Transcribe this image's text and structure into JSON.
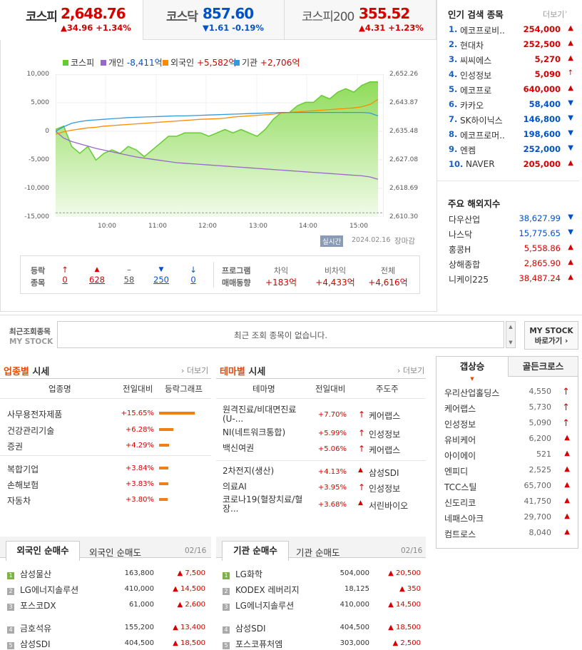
{
  "tabs": [
    {
      "name": "코스피",
      "value": "2,648.76",
      "change": "▲34.96 +1.34%",
      "dir": "up"
    },
    {
      "name": "코스닥",
      "value": "857.60",
      "change": "▼1.61 -0.19%",
      "dir": "dn"
    },
    {
      "name": "코스피200",
      "value": "355.52",
      "change": "▲4.31 +1.23%",
      "dir": "up"
    }
  ],
  "legend": [
    {
      "name": "코스피",
      "value": "",
      "color": "#66cc33"
    },
    {
      "name": "개인",
      "value": "-8,411억",
      "color": "#9966cc",
      "dir": "dn"
    },
    {
      "name": "외국인",
      "value": "+5,582억",
      "color": "#ff8a00",
      "dir": "up"
    },
    {
      "name": "기관",
      "value": "+2,706억",
      "color": "#3399dd",
      "dir": "up"
    }
  ],
  "chart_data": {
    "type": "line",
    "title": "",
    "x": [
      "09:00",
      "10:00",
      "11:00",
      "12:00",
      "13:00",
      "14:00",
      "15:00",
      "15:30"
    ],
    "x_ticks": [
      "10:00",
      "11:00",
      "12:00",
      "13:00",
      "14:00",
      "15:00"
    ],
    "ylim_left": [
      -15000,
      10000
    ],
    "y_ticks_left": [
      "10,000",
      "5,000",
      "0",
      "-5,000",
      "-10,000",
      "-15,000"
    ],
    "ylim_right": [
      2610.3,
      2652.26
    ],
    "y_ticks_right": [
      "2,652.26",
      "2,643.87",
      "2,635.48",
      "2,627.08",
      "2,618.69",
      "2,610.30"
    ],
    "series": [
      {
        "name": "코스피",
        "axis": "right",
        "type": "area",
        "color": "#66cc33",
        "values": [
          2636,
          2637,
          2631,
          2629,
          2631,
          2627,
          2629,
          2630,
          2629,
          2631,
          2630,
          2628,
          2630,
          2632,
          2634,
          2634,
          2635,
          2635,
          2635,
          2634,
          2635,
          2636,
          2635,
          2636,
          2635,
          2634,
          2636,
          2639,
          2641,
          2641,
          2643,
          2644,
          2644,
          2646,
          2645,
          2647,
          2648,
          2647,
          2649,
          2650,
          2650
        ]
      },
      {
        "name": "개인",
        "axis": "left",
        "values": [
          0,
          -1200,
          -1800,
          -2200,
          -2600,
          -3000,
          -3300,
          -3600,
          -3900,
          -4200,
          -4500,
          -4700,
          -4900,
          -5100,
          -5300,
          -5500,
          -5600,
          -5700,
          -5800,
          -5900,
          -6000,
          -6100,
          -6200,
          -6300,
          -6400,
          -6500,
          -6600,
          -6700,
          -6800,
          -6900,
          -7000,
          -7100,
          -7200,
          -7300,
          -7400,
          -7500,
          -7600,
          -7700,
          -7800,
          -8000,
          -8411
        ]
      },
      {
        "name": "외국인",
        "axis": "left",
        "values": [
          -500,
          -100,
          200,
          400,
          600,
          700,
          900,
          1000,
          1100,
          1200,
          1300,
          1400,
          1500,
          1600,
          1700,
          1800,
          1900,
          2000,
          2100,
          2150,
          2200,
          2300,
          2500,
          2600,
          2700,
          2800,
          2900,
          3000,
          3200,
          3300,
          3400,
          3500,
          3600,
          3700,
          3800,
          3900,
          4000,
          4100,
          4300,
          4700,
          5582
        ]
      },
      {
        "name": "기관",
        "axis": "left",
        "values": [
          0,
          800,
          1400,
          1700,
          1900,
          2000,
          2100,
          2200,
          2300,
          2400,
          2450,
          2500,
          2550,
          2600,
          2650,
          2700,
          2700,
          2750,
          2800,
          2850,
          2900,
          2950,
          3000,
          3050,
          3100,
          3150,
          3200,
          3250,
          3300,
          3300,
          3300,
          3300,
          3300,
          3300,
          3300,
          3300,
          3300,
          3300,
          3300,
          3200,
          2706
        ]
      }
    ]
  },
  "chart_footer": {
    "badge": "실시간",
    "date": "2024.02.16",
    "status": "장마감"
  },
  "stats": {
    "head1": "등락",
    "head2": "종목",
    "items": [
      {
        "sym": "↑",
        "val": "0",
        "dir": "up"
      },
      {
        "sym": "▲",
        "val": "628",
        "dir": "up"
      },
      {
        "sym": "–",
        "val": "58",
        "dir": "eq"
      },
      {
        "sym": "▼",
        "val": "250",
        "dir": "dn"
      },
      {
        "sym": "↓",
        "val": "0",
        "dir": "dn"
      }
    ],
    "prog1": "프로그램",
    "prog2": "매매동향",
    "prog": [
      {
        "label": "차익",
        "val": "+183억"
      },
      {
        "label": "비차익",
        "val": "+4,433억"
      },
      {
        "label": "전체",
        "val": "+4,616억"
      }
    ]
  },
  "popular": {
    "title": "인기 검색 종목",
    "more": "더보기",
    "items": [
      {
        "rank": "1.",
        "name": "에코프로비..",
        "value": "254,000",
        "arrow": "▲",
        "dir": "up"
      },
      {
        "rank": "2.",
        "name": "현대차",
        "value": "252,500",
        "arrow": "▲",
        "dir": "up"
      },
      {
        "rank": "3.",
        "name": "씨씨에스",
        "value": "5,270",
        "arrow": "▲",
        "dir": "up"
      },
      {
        "rank": "4.",
        "name": "인성정보",
        "value": "5,090",
        "arrow": "↑",
        "dir": "up"
      },
      {
        "rank": "5.",
        "name": "에코프로",
        "value": "640,000",
        "arrow": "▲",
        "dir": "up"
      },
      {
        "rank": "6.",
        "name": "카카오",
        "value": "58,400",
        "arrow": "▼",
        "dir": "dn"
      },
      {
        "rank": "7.",
        "name": "SK하이닉스",
        "value": "146,800",
        "arrow": "▼",
        "dir": "dn"
      },
      {
        "rank": "8.",
        "name": "에코프로머..",
        "value": "198,600",
        "arrow": "▼",
        "dir": "dn"
      },
      {
        "rank": "9.",
        "name": "엔켐",
        "value": "252,000",
        "arrow": "▼",
        "dir": "dn"
      },
      {
        "rank": "10.",
        "name": "NAVER",
        "value": "205,000",
        "arrow": "▲",
        "dir": "up"
      }
    ]
  },
  "overseas": {
    "title": "주요 해외지수",
    "items": [
      {
        "name": "다우산업",
        "value": "38,627.99",
        "arrow": "▼",
        "dir": "dn"
      },
      {
        "name": "나스닥",
        "value": "15,775.65",
        "arrow": "▼",
        "dir": "dn"
      },
      {
        "name": "홍콩H",
        "value": "5,558.86",
        "arrow": "▲",
        "dir": "up"
      },
      {
        "name": "상해종합",
        "value": "2,865.90",
        "arrow": "▲",
        "dir": "up"
      },
      {
        "name": "니케이225",
        "value": "38,487.24",
        "arrow": "▲",
        "dir": "up"
      }
    ]
  },
  "recent": {
    "label1": "최근조회종목",
    "label2": "MY STOCK",
    "empty": "최근 조회 종목이 없습니다.",
    "btn1": "MY STOCK",
    "btn2": "바로가기 ›"
  },
  "industry": {
    "title_a": "업종별",
    "title_b": " 시세",
    "more": "더보기",
    "h1": "업종명",
    "h2": "전일대비",
    "h3": "등락그래프",
    "rows": [
      {
        "name": "사무용전자제품",
        "pct": "+15.65%",
        "bar": 1.0
      },
      {
        "name": "건강관리기술",
        "pct": "+6.28%",
        "bar": 0.4
      },
      {
        "name": "증권",
        "pct": "+4.29%",
        "bar": 0.27
      },
      {
        "name": "복합기업",
        "pct": "+3.84%",
        "bar": 0.25
      },
      {
        "name": "손해보험",
        "pct": "+3.83%",
        "bar": 0.25
      },
      {
        "name": "자동차",
        "pct": "+3.80%",
        "bar": 0.24
      }
    ]
  },
  "theme": {
    "title_a": "테마별",
    "title_b": " 시세",
    "more": "더보기",
    "h1": "테마명",
    "h2": "전일대비",
    "h3": "주도주",
    "rows": [
      {
        "name": "원격진료/비대면진료(U-...",
        "pct": "+7.70%",
        "arrow": "↑",
        "lead": "케어랩스"
      },
      {
        "name": "NI(네트워크통합)",
        "pct": "+5.99%",
        "arrow": "↑",
        "lead": "인성정보"
      },
      {
        "name": "백신여권",
        "pct": "+5.06%",
        "arrow": "↑",
        "lead": "케어랩스"
      },
      {
        "name": "2차전지(생산)",
        "pct": "+4.13%",
        "arrow": "▲",
        "lead": "삼성SDI"
      },
      {
        "name": "의료AI",
        "pct": "+3.95%",
        "arrow": "↑",
        "lead": "인성정보"
      },
      {
        "name": "코로나19(혈장치료/혈장...",
        "pct": "+3.68%",
        "arrow": "▲",
        "lead": "서린바이오"
      }
    ]
  },
  "cap": {
    "tab1": "갭상승",
    "tab2": "골든크로스",
    "rows": [
      {
        "name": "우리산업홀딩스",
        "value": "4,550",
        "arrow": "↑"
      },
      {
        "name": "케어랩스",
        "value": "5,730",
        "arrow": "↑"
      },
      {
        "name": "인성정보",
        "value": "5,090",
        "arrow": "↑"
      },
      {
        "name": "유비케어",
        "value": "6,200",
        "arrow": "▲"
      },
      {
        "name": "아이에이",
        "value": "521",
        "arrow": "▲"
      },
      {
        "name": "엔피디",
        "value": "2,525",
        "arrow": "▲"
      },
      {
        "name": "TCC스틸",
        "value": "65,700",
        "arrow": "▲"
      },
      {
        "name": "신도리코",
        "value": "41,750",
        "arrow": "▲"
      },
      {
        "name": "네패스아크",
        "value": "29,700",
        "arrow": "▲"
      },
      {
        "name": "컴트로스",
        "value": "8,040",
        "arrow": "▲"
      }
    ]
  },
  "foreign": {
    "tab1": "외국인 순매수",
    "tab2": "외국인 순매도",
    "date": "02/16",
    "rows": [
      {
        "rank": "1",
        "name": "삼성물산",
        "price": "163,800",
        "chg": "▲ 7,500"
      },
      {
        "rank": "2",
        "name": "LG에너지솔루션",
        "price": "410,000",
        "chg": "▲ 14,500"
      },
      {
        "rank": "3",
        "name": "포스코DX",
        "price": "61,000",
        "chg": "▲ 2,600"
      },
      {
        "rank": "4",
        "name": "금호석유",
        "price": "155,200",
        "chg": "▲ 13,400"
      },
      {
        "rank": "5",
        "name": "삼성SDI",
        "price": "404,500",
        "chg": "▲ 18,500"
      }
    ]
  },
  "inst": {
    "tab1": "기관 순매수",
    "tab2": "기관 순매도",
    "date": "02/16",
    "rows": [
      {
        "rank": "1",
        "name": "LG화학",
        "price": "504,000",
        "chg": "▲ 20,500"
      },
      {
        "rank": "2",
        "name": "KODEX 레버리지",
        "price": "18,125",
        "chg": "▲ 350"
      },
      {
        "rank": "3",
        "name": "LG에너지솔루션",
        "price": "410,000",
        "chg": "▲ 14,500"
      },
      {
        "rank": "4",
        "name": "삼성SDI",
        "price": "404,500",
        "chg": "▲ 18,500"
      },
      {
        "rank": "5",
        "name": "포스코퓨처엠",
        "price": "303,000",
        "chg": "▲ 2,500"
      }
    ]
  }
}
